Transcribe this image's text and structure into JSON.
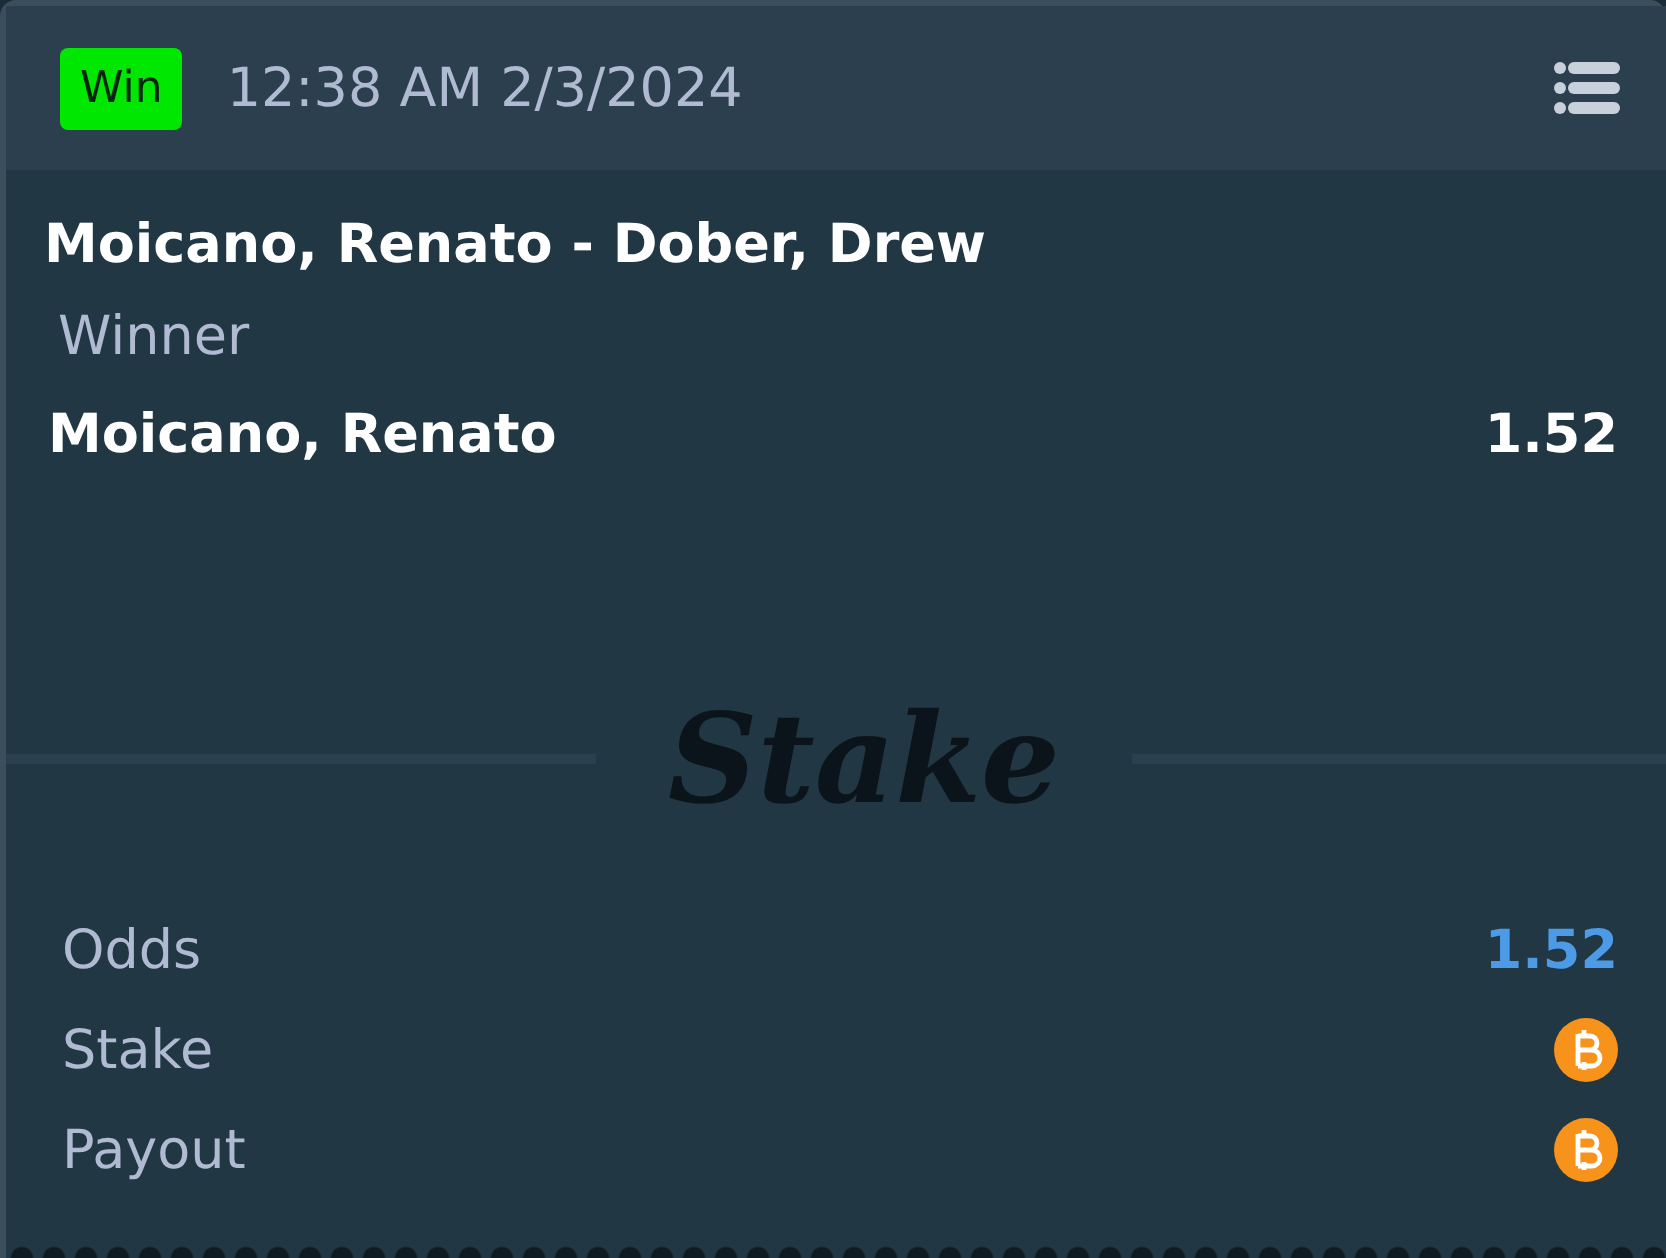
{
  "header": {
    "status": {
      "label": "Win",
      "kind": "win"
    },
    "time": "12:38 AM 2/3/2024"
  },
  "bet": {
    "event": "Moicano, Renato - Dober, Drew",
    "market": "Winner",
    "selection": "Moicano, Renato",
    "odds": "1.52"
  },
  "logo": "Stake",
  "summary": [
    {
      "label": "Odds",
      "kind": "text",
      "value": "1.52"
    },
    {
      "label": "Stake",
      "kind": "coin"
    },
    {
      "label": "Payout",
      "kind": "coin"
    }
  ]
}
